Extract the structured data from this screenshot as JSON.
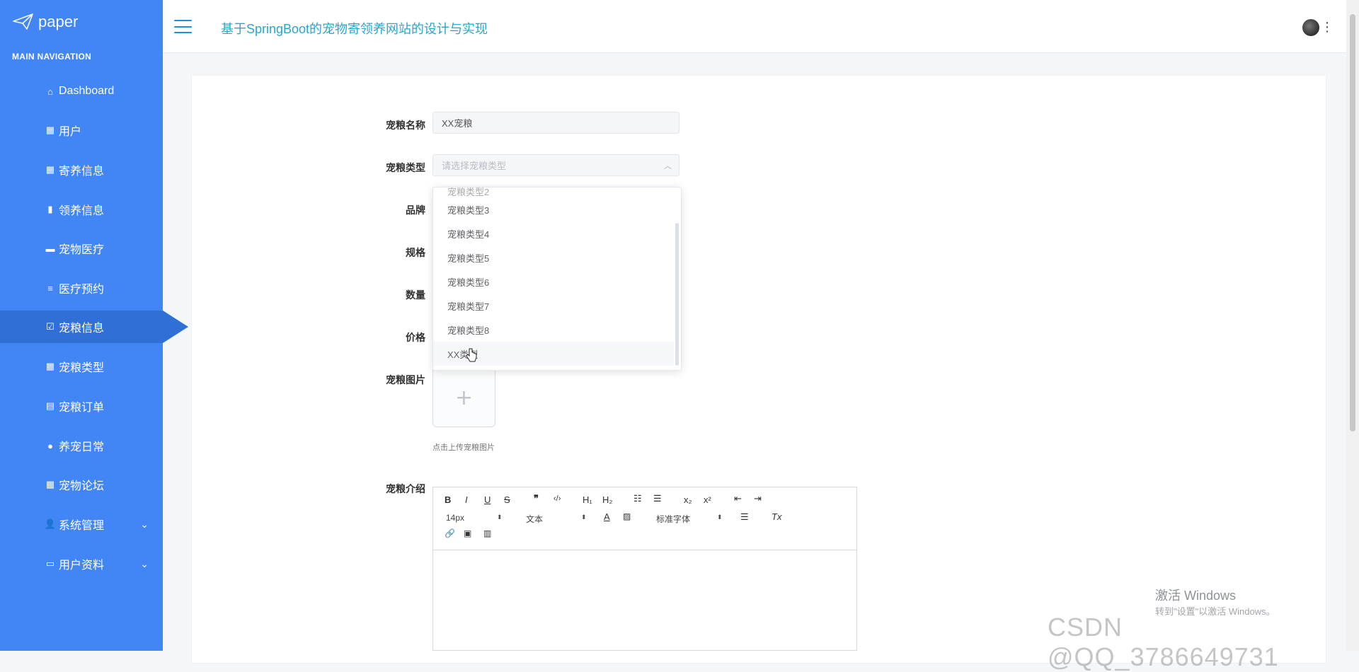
{
  "sidebar": {
    "logo_text": "paper",
    "nav_title": "MAIN NAVIGATION",
    "items": [
      {
        "label": "Dashboard",
        "icon": "home-icon"
      },
      {
        "label": "用户",
        "icon": "grid-icon"
      },
      {
        "label": "寄养信息",
        "icon": "grid-icon"
      },
      {
        "label": "领养信息",
        "icon": "bar-chart-icon"
      },
      {
        "label": "宠物医疗",
        "icon": "briefcase-icon"
      },
      {
        "label": "医疗预约",
        "icon": "list-icon"
      },
      {
        "label": "宠粮信息",
        "icon": "check-square-icon",
        "active": true
      },
      {
        "label": "宠粮类型",
        "icon": "grid-icon"
      },
      {
        "label": "宠粮订单",
        "icon": "clipboard-icon"
      },
      {
        "label": "养宠日常",
        "icon": "pin-icon"
      },
      {
        "label": "宠物论坛",
        "icon": "grid-icon"
      },
      {
        "label": "系统管理",
        "icon": "user-icon",
        "expandable": true
      },
      {
        "label": "用户资料",
        "icon": "card-icon",
        "expandable": true
      }
    ]
  },
  "header": {
    "title": "基于SpringBoot的宠物寄领养网站的设计与实现"
  },
  "form": {
    "name_label": "宠粮名称",
    "name_value": "XX宠粮",
    "type_label": "宠粮类型",
    "type_placeholder": "请选择宠粮类型",
    "brand_label": "品牌",
    "spec_label": "规格",
    "qty_label": "数量",
    "price_label": "价格",
    "image_label": "宠粮图片",
    "upload_hint": "点击上传宠粮图片",
    "intro_label": "宠粮介绍"
  },
  "dropdown": {
    "options": [
      "宠粮类型2",
      "宠粮类型3",
      "宠粮类型4",
      "宠粮类型5",
      "宠粮类型6",
      "宠粮类型7",
      "宠粮类型8",
      "XX类型"
    ],
    "hovered": "XX类型"
  },
  "editor": {
    "font_size": "14px",
    "block_format": "文本",
    "font_family": "标准字体"
  },
  "watermark": {
    "win_title": "激活 Windows",
    "win_sub": "转到\"设置\"以激活 Windows。",
    "csdn": "CSDN @QQ_3786649731"
  }
}
